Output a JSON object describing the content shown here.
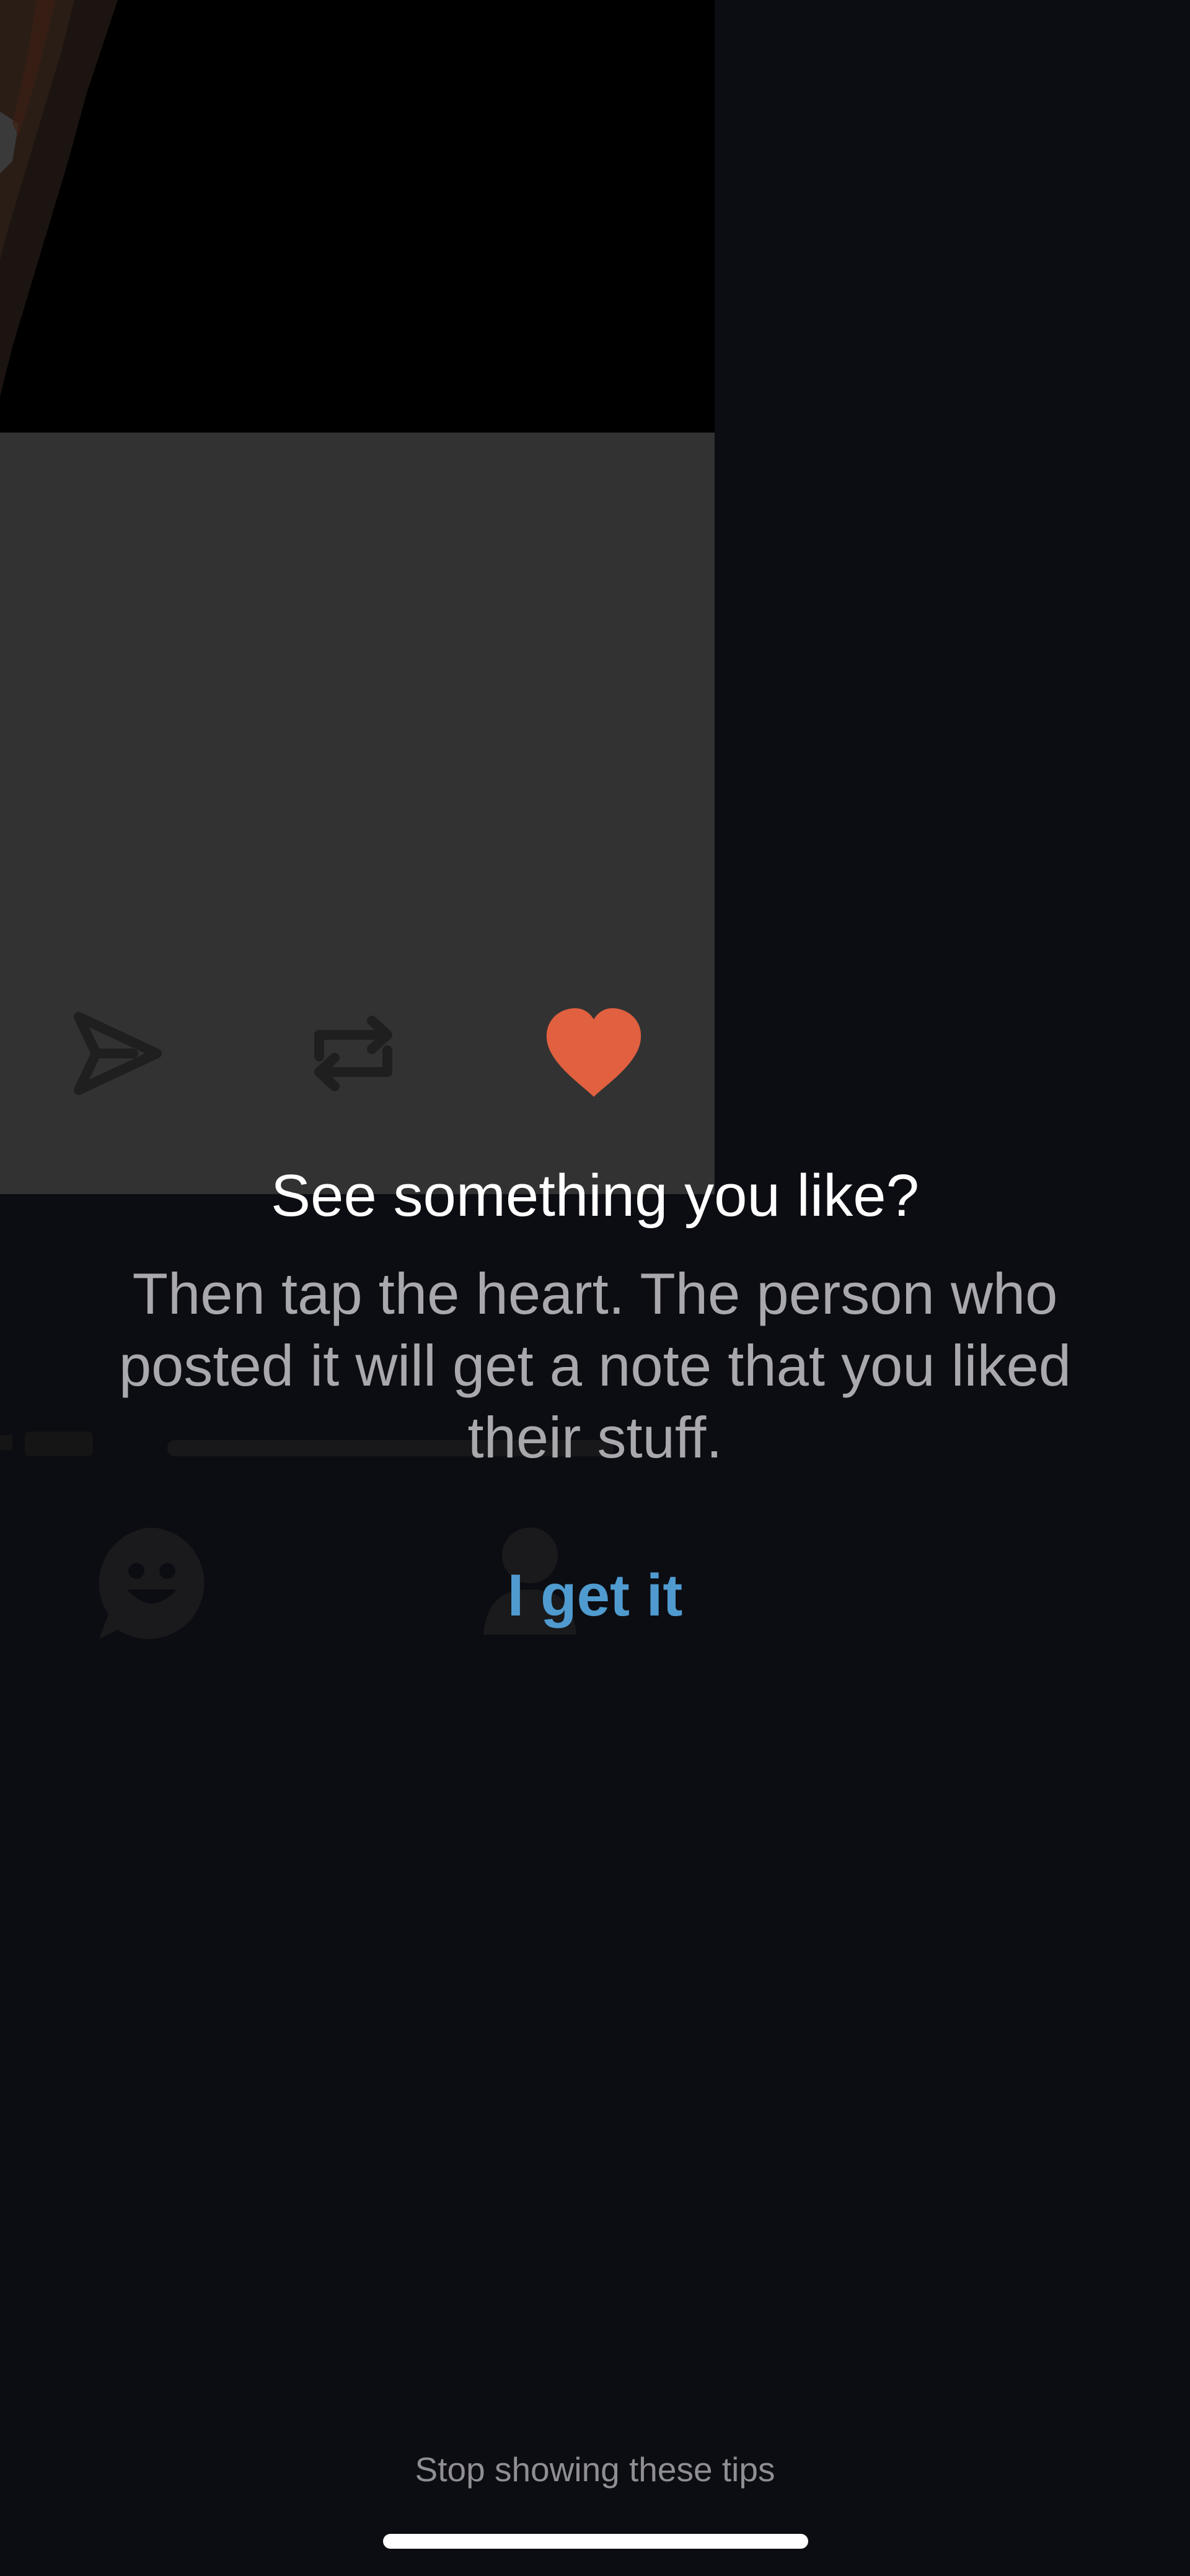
{
  "tip": {
    "title": "See something you like?",
    "body": "Then tap the heart. The person who posted it will get a note that you liked their stuff.",
    "confirm_label": "I get it",
    "stop_label": "Stop showing these tips"
  },
  "post_actions": {
    "share_icon": "send-icon",
    "reblog_icon": "reblog-icon",
    "like_icon": "heart-icon"
  },
  "colors": {
    "heart": "#e0603f",
    "accent": "#4f9bd0",
    "background": "#0c0d12",
    "card": "#323232"
  }
}
